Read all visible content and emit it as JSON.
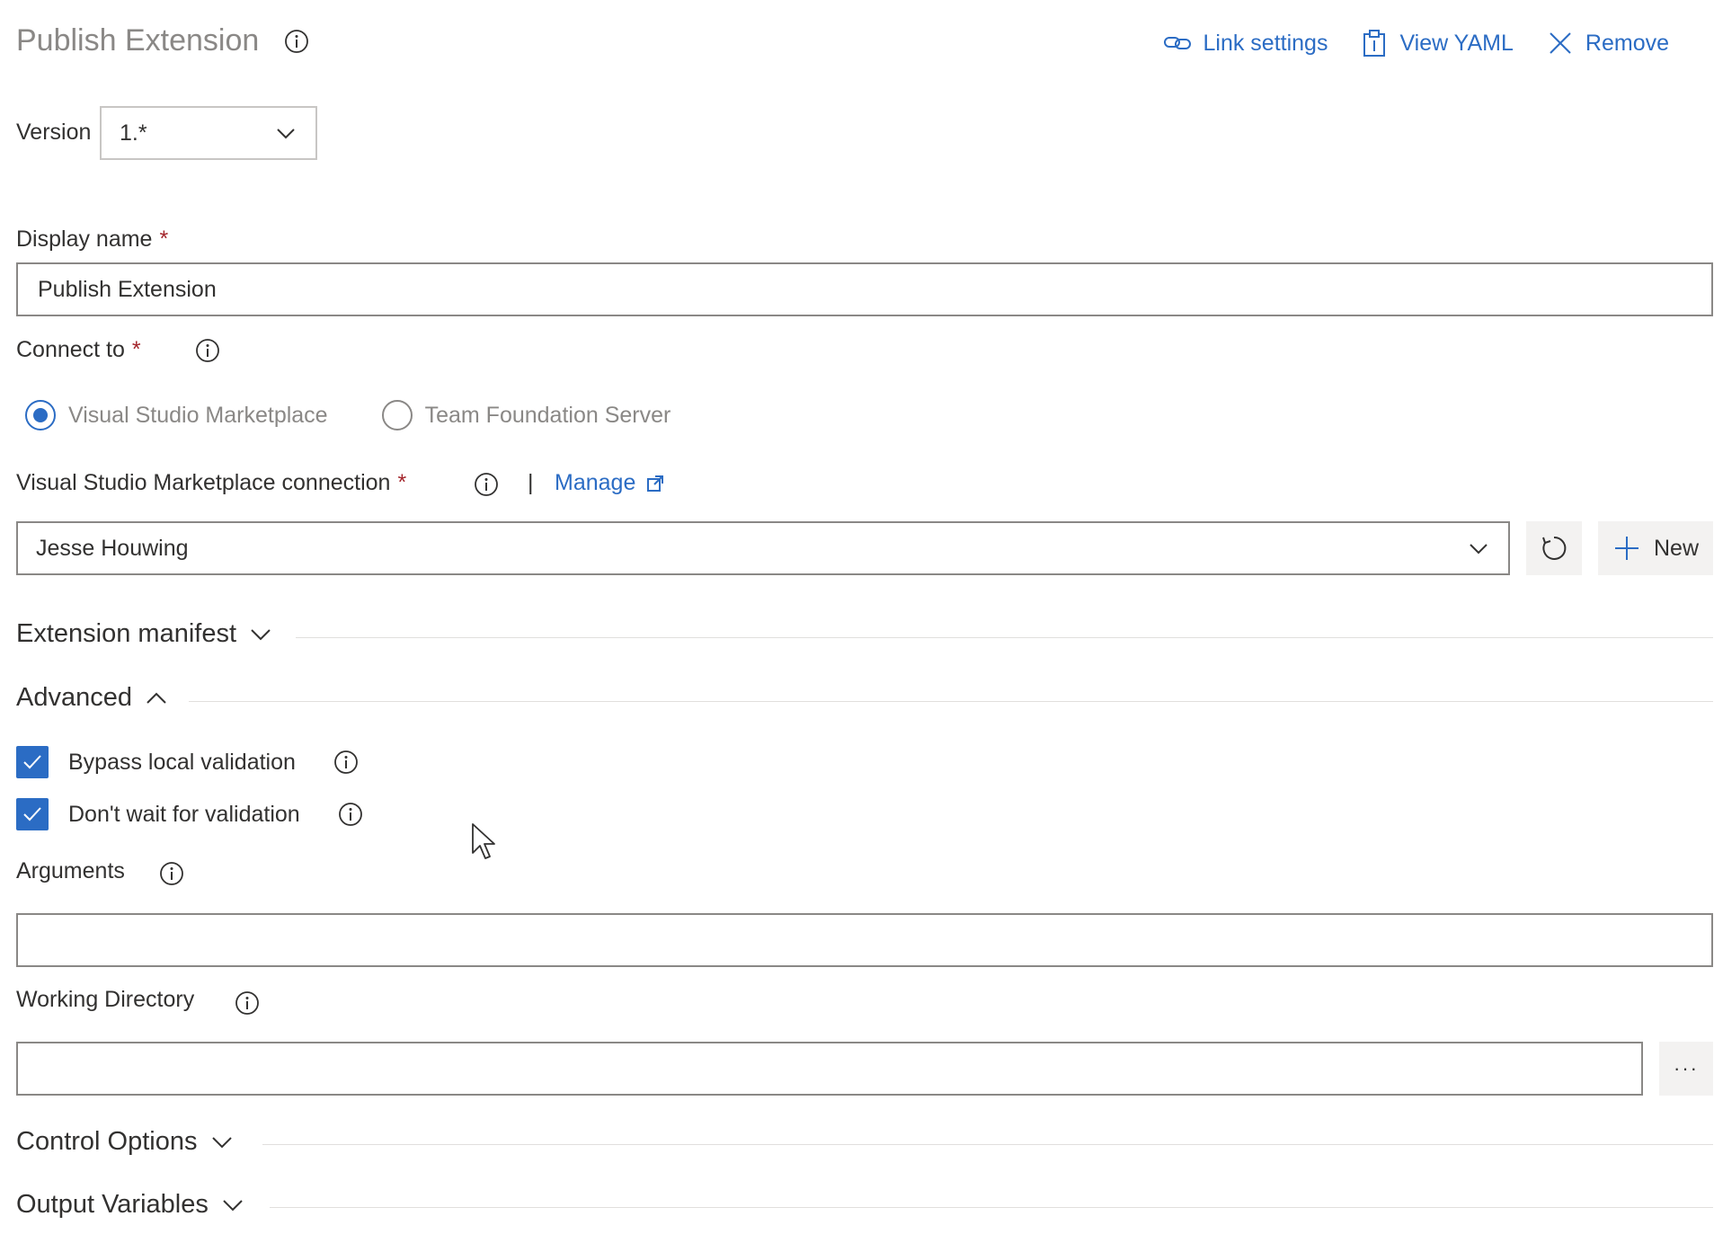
{
  "header": {
    "title": "Publish Extension",
    "actions": {
      "link_settings": "Link settings",
      "view_yaml": "View YAML",
      "remove": "Remove"
    }
  },
  "version": {
    "label": "Version",
    "value": "1.*"
  },
  "display_name": {
    "label": "Display name",
    "required": "*",
    "value": "Publish Extension"
  },
  "connect_to": {
    "label": "Connect to",
    "required": "*",
    "options": [
      "Visual Studio Marketplace",
      "Team Foundation Server"
    ],
    "selected": "Visual Studio Marketplace"
  },
  "marketplace_connection": {
    "label": "Visual Studio Marketplace connection",
    "required": "*",
    "separator": "|",
    "manage_label": "Manage",
    "value": "Jesse Houwing",
    "new_label": "New"
  },
  "sections": {
    "extension_manifest": "Extension manifest",
    "advanced": "Advanced",
    "control_options": "Control Options",
    "output_variables": "Output Variables"
  },
  "advanced": {
    "bypass_local_validation": {
      "label": "Bypass local validation",
      "checked": true
    },
    "dont_wait_for_validation": {
      "label": "Don't wait for validation",
      "checked": true
    },
    "arguments": {
      "label": "Arguments",
      "value": ""
    },
    "working_directory": {
      "label": "Working Directory",
      "value": "",
      "browse_label": "···"
    }
  },
  "colors": {
    "accent": "#2b6cc4",
    "required": "#a4262c",
    "muted_text": "#8a8886",
    "text": "#323130"
  }
}
